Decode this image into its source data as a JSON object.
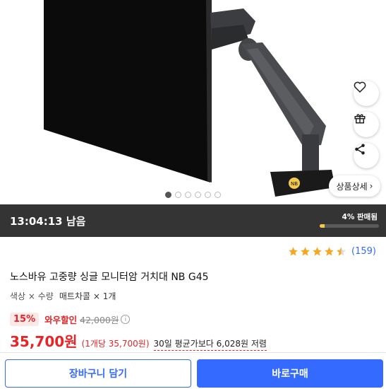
{
  "hero": {
    "detail_button_label": "상품상세",
    "detail_button_arrow": "›",
    "stand_logo": "NB",
    "image_count": 6,
    "active_image_index": 0
  },
  "timer": {
    "remaining_label": "13:04:13 남음",
    "sold_label": "4% 판매됨",
    "sold_fraction": 0.04,
    "accent": "#f2c94c"
  },
  "rating": {
    "stars": 4.5,
    "count_label": "(159)",
    "star_color": "#f5a623"
  },
  "product": {
    "title": "노스바유 고중량 싱글 모니터암 거치대 NB G45",
    "option_label": "색상 × 수량",
    "option_value": "매트차콜 × 1개"
  },
  "pricing": {
    "discount_badge": "15%",
    "wow_label": "와우할인",
    "original_price": "42,000원",
    "info_icon": "ⓘ",
    "price": "35,700원",
    "unit_price": "(1개당 35,700원)",
    "avg_note": "30일 평균가보다 6,028원 저렴",
    "price_color": "#e52528"
  },
  "actions": {
    "cart_label": "장바구니 담기",
    "buy_label": "바로구매",
    "brand_color": "#346aff"
  },
  "icons": {
    "wishlist": "heart-icon",
    "gift": "gift-icon",
    "share": "share-icon"
  }
}
